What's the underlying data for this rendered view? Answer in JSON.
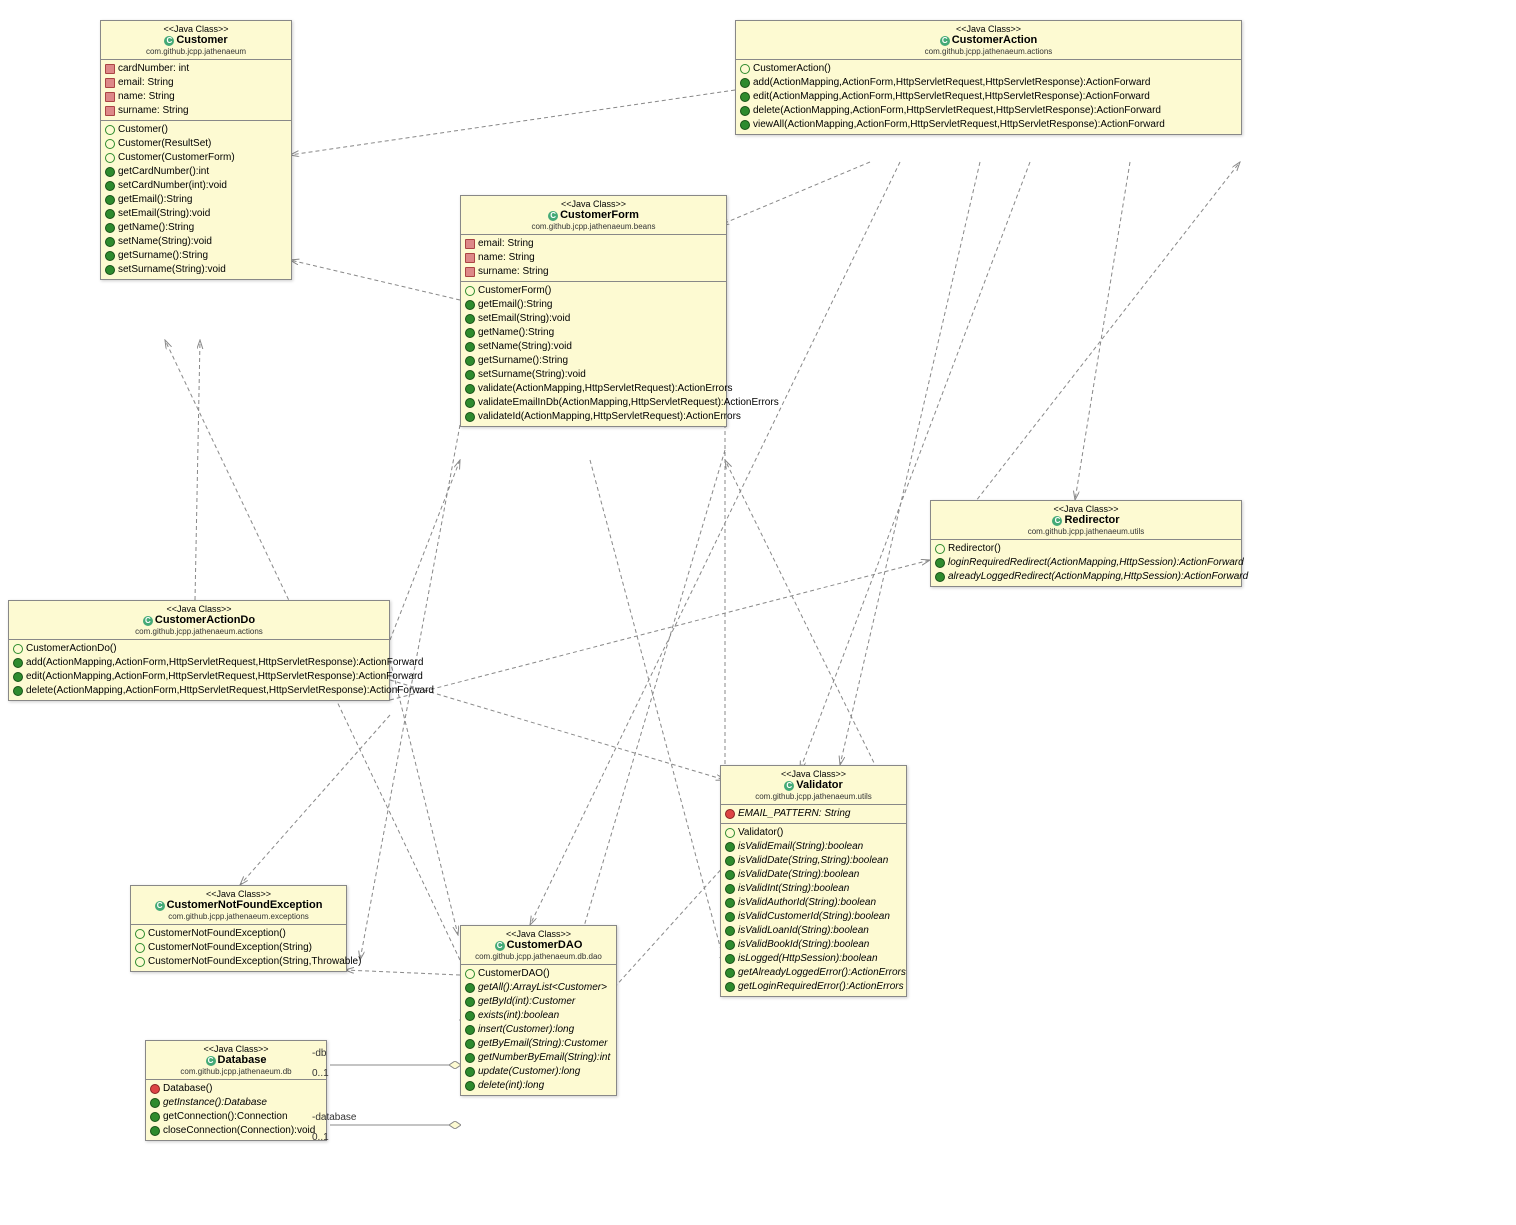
{
  "stereotype": "<<Java Class>>",
  "diagram_type": "UML Class Diagram",
  "classes": {
    "customer": {
      "name": "Customer",
      "package": "com.github.jcpp.jathenaeum",
      "fields": [
        {
          "icon": "sq",
          "label": "cardNumber: int"
        },
        {
          "icon": "sq",
          "label": "email: String"
        },
        {
          "icon": "sq",
          "label": "name: String"
        },
        {
          "icon": "sq",
          "label": "surname: String"
        }
      ],
      "methods": [
        {
          "icon": "ctor",
          "label": "Customer()"
        },
        {
          "icon": "ctor",
          "label": "Customer(ResultSet)"
        },
        {
          "icon": "ctor",
          "label": "Customer(CustomerForm)"
        },
        {
          "icon": "green",
          "label": "getCardNumber():int"
        },
        {
          "icon": "green",
          "label": "setCardNumber(int):void"
        },
        {
          "icon": "green",
          "label": "getEmail():String"
        },
        {
          "icon": "green",
          "label": "setEmail(String):void"
        },
        {
          "icon": "green",
          "label": "getName():String"
        },
        {
          "icon": "green",
          "label": "setName(String):void"
        },
        {
          "icon": "green",
          "label": "getSurname():String"
        },
        {
          "icon": "green",
          "label": "setSurname(String):void"
        }
      ]
    },
    "customerAction": {
      "name": "CustomerAction",
      "package": "com.github.jcpp.jathenaeum.actions",
      "methods": [
        {
          "icon": "ctor",
          "label": "CustomerAction()"
        },
        {
          "icon": "green",
          "label": "add(ActionMapping,ActionForm,HttpServletRequest,HttpServletResponse):ActionForward"
        },
        {
          "icon": "green",
          "label": "edit(ActionMapping,ActionForm,HttpServletRequest,HttpServletResponse):ActionForward"
        },
        {
          "icon": "green",
          "label": "delete(ActionMapping,ActionForm,HttpServletRequest,HttpServletResponse):ActionForward"
        },
        {
          "icon": "green",
          "label": "viewAll(ActionMapping,ActionForm,HttpServletRequest,HttpServletResponse):ActionForward"
        }
      ]
    },
    "customerForm": {
      "name": "CustomerForm",
      "package": "com.github.jcpp.jathenaeum.beans",
      "fields": [
        {
          "icon": "sq",
          "label": "email: String"
        },
        {
          "icon": "sq",
          "label": "name: String"
        },
        {
          "icon": "sq",
          "label": "surname: String"
        }
      ],
      "methods": [
        {
          "icon": "ctor",
          "label": "CustomerForm()"
        },
        {
          "icon": "green",
          "label": "getEmail():String"
        },
        {
          "icon": "green",
          "label": "setEmail(String):void"
        },
        {
          "icon": "green",
          "label": "getName():String"
        },
        {
          "icon": "green",
          "label": "setName(String):void"
        },
        {
          "icon": "green",
          "label": "getSurname():String"
        },
        {
          "icon": "green",
          "label": "setSurname(String):void"
        },
        {
          "icon": "green",
          "label": "validate(ActionMapping,HttpServletRequest):ActionErrors"
        },
        {
          "icon": "green",
          "label": "validateEmailInDb(ActionMapping,HttpServletRequest):ActionErrors"
        },
        {
          "icon": "green",
          "label": "validateId(ActionMapping,HttpServletRequest):ActionErrors"
        }
      ]
    },
    "redirector": {
      "name": "Redirector",
      "package": "com.github.jcpp.jathenaeum.utils",
      "methods": [
        {
          "icon": "ctor",
          "label": "Redirector()"
        },
        {
          "icon": "green",
          "label": "loginRequiredRedirect(ActionMapping,HttpSession):ActionForward",
          "s": true
        },
        {
          "icon": "green",
          "label": "alreadyLoggedRedirect(ActionMapping,HttpSession):ActionForward",
          "s": true
        }
      ]
    },
    "customerActionDo": {
      "name": "CustomerActionDo",
      "package": "com.github.jcpp.jathenaeum.actions",
      "methods": [
        {
          "icon": "ctor",
          "label": "CustomerActionDo()"
        },
        {
          "icon": "green",
          "label": "add(ActionMapping,ActionForm,HttpServletRequest,HttpServletResponse):ActionForward"
        },
        {
          "icon": "green",
          "label": "edit(ActionMapping,ActionForm,HttpServletRequest,HttpServletResponse):ActionForward"
        },
        {
          "icon": "green",
          "label": "delete(ActionMapping,ActionForm,HttpServletRequest,HttpServletResponse):ActionForward"
        }
      ]
    },
    "validator": {
      "name": "Validator",
      "package": "com.github.jcpp.jathenaeum.utils",
      "fields": [
        {
          "icon": "red",
          "label": "EMAIL_PATTERN: String",
          "s": true
        }
      ],
      "methods": [
        {
          "icon": "ctor",
          "label": "Validator()"
        },
        {
          "icon": "green",
          "label": "isValidEmail(String):boolean",
          "s": true
        },
        {
          "icon": "green",
          "label": "isValidDate(String,String):boolean",
          "s": true
        },
        {
          "icon": "green",
          "label": "isValidDate(String):boolean",
          "s": true
        },
        {
          "icon": "green",
          "label": "isValidInt(String):boolean",
          "s": true
        },
        {
          "icon": "green",
          "label": "isValidAuthorId(String):boolean",
          "s": true
        },
        {
          "icon": "green",
          "label": "isValidCustomerId(String):boolean",
          "s": true
        },
        {
          "icon": "green",
          "label": "isValidLoanId(String):boolean",
          "s": true
        },
        {
          "icon": "green",
          "label": "isValidBookId(String):boolean",
          "s": true
        },
        {
          "icon": "green",
          "label": "isLogged(HttpSession):boolean",
          "s": true
        },
        {
          "icon": "green",
          "label": "getAlreadyLoggedError():ActionErrors",
          "s": true
        },
        {
          "icon": "green",
          "label": "getLoginRequiredError():ActionErrors",
          "s": true
        }
      ]
    },
    "notFound": {
      "name": "CustomerNotFoundException",
      "package": "com.github.jcpp.jathenaeum.exceptions",
      "methods": [
        {
          "icon": "ctor",
          "label": "CustomerNotFoundException()"
        },
        {
          "icon": "ctor",
          "label": "CustomerNotFoundException(String)"
        },
        {
          "icon": "ctor",
          "label": "CustomerNotFoundException(String,Throwable)"
        }
      ]
    },
    "customerDAO": {
      "name": "CustomerDAO",
      "package": "com.github.jcpp.jathenaeum.db.dao",
      "methods": [
        {
          "icon": "ctor",
          "label": "CustomerDAO()"
        },
        {
          "icon": "green",
          "label": "getAll():ArrayList<Customer>",
          "s": true
        },
        {
          "icon": "green",
          "label": "getById(int):Customer",
          "s": true
        },
        {
          "icon": "green",
          "label": "exists(int):boolean",
          "s": true
        },
        {
          "icon": "green",
          "label": "insert(Customer):long",
          "s": true
        },
        {
          "icon": "green",
          "label": "getByEmail(String):Customer",
          "s": true
        },
        {
          "icon": "green",
          "label": "getNumberByEmail(String):int",
          "s": true
        },
        {
          "icon": "green",
          "label": "update(Customer):long",
          "s": true
        },
        {
          "icon": "green",
          "label": "delete(int):long",
          "s": true
        }
      ]
    },
    "database": {
      "name": "Database",
      "package": "com.github.jcpp.jathenaeum.db",
      "methods": [
        {
          "icon": "red",
          "label": "Database()"
        },
        {
          "icon": "green",
          "label": "getInstance():Database",
          "s": true
        },
        {
          "icon": "green",
          "label": "getConnection():Connection"
        },
        {
          "icon": "green",
          "label": "closeConnection(Connection):void"
        }
      ]
    }
  },
  "labels": {
    "db": "-db",
    "database": "-database",
    "mult": "0..1"
  },
  "colors": {
    "boxFill": "#fdfad2",
    "border": "#888888"
  }
}
